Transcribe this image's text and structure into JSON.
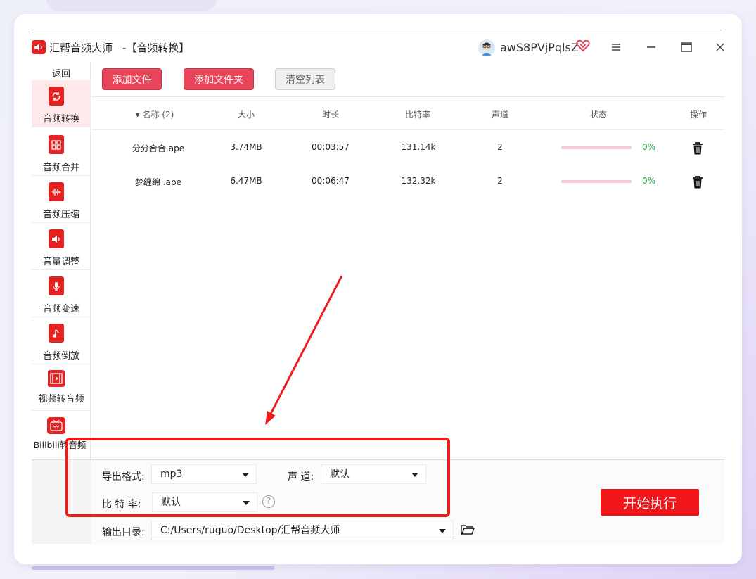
{
  "app": {
    "name": "汇帮音频大师",
    "page_title": "-【音频转换】",
    "username": "awS8PVjPqlsZ"
  },
  "sidebar": {
    "back_label": "返回",
    "items": [
      {
        "label": "音频转换",
        "icon": "audio-convert-icon",
        "active": true
      },
      {
        "label": "音频合并",
        "icon": "audio-merge-icon",
        "active": false
      },
      {
        "label": "音频压缩",
        "icon": "audio-compress-icon",
        "active": false
      },
      {
        "label": "音量调整",
        "icon": "volume-adjust-icon",
        "active": false
      },
      {
        "label": "音频变速",
        "icon": "microphone-icon",
        "active": false
      },
      {
        "label": "音频倒放",
        "icon": "music-note-icon",
        "active": false
      },
      {
        "label": "视频转音频",
        "icon": "film-strip-icon",
        "active": false
      },
      {
        "label": "Bilibili转音频",
        "icon": "tv-icon",
        "active": false
      }
    ]
  },
  "toolbar": {
    "add_file": "添加文件",
    "add_folder": "添加文件夹",
    "clear_list": "清空列表"
  },
  "table": {
    "columns": [
      "▾ 名称 (2)",
      "大小",
      "时长",
      "比特率",
      "声道",
      "状态",
      "操作"
    ],
    "rows": [
      {
        "name": "分分合合.ape",
        "size": "3.74MB",
        "duration": "00:03:57",
        "bitrate": "131.14k",
        "channels": "2",
        "progress": 0,
        "status": "0%"
      },
      {
        "name": "梦缠绵 .ape",
        "size": "6.47MB",
        "duration": "00:06:47",
        "bitrate": "132.32k",
        "channels": "2",
        "progress": 0,
        "status": "0%"
      }
    ]
  },
  "settings": {
    "format_label": "导出格式:",
    "format_value": "mp3",
    "channel_label": "声 道:",
    "channel_value": "默认",
    "bitrate_label": "比 特 率:",
    "bitrate_value": "默认",
    "help_glyph": "?",
    "output_label": "输出目录:",
    "output_value": "C:/Users/ruguo/Desktop/汇帮音频大师",
    "start_button": "开始执行"
  },
  "colors": {
    "accent": "#e8455a",
    "sidebar_icon": "#e52222",
    "start_button": "#f0161a",
    "annotation": "#ef1a1a",
    "status_ok": "#1aa33a"
  }
}
